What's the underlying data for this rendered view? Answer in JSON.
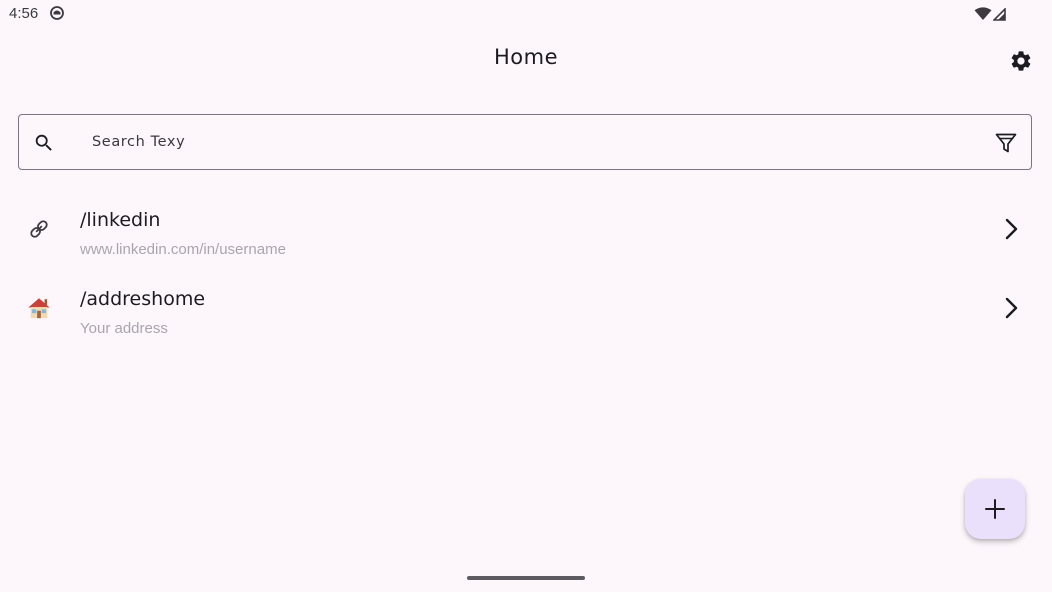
{
  "status_bar": {
    "time": "4:56",
    "app_icon": "notification-app-icon",
    "wifi_icon": "wifi-icon",
    "signal_icon": "cell-signal-icon"
  },
  "top_bar": {
    "title": "Home",
    "settings_icon": "gear-icon"
  },
  "search": {
    "placeholder": "Search Texy",
    "value": "",
    "search_icon": "search-icon",
    "filter_icon": "filter-icon"
  },
  "items": [
    {
      "title": "/linkedin",
      "subtitle": "www.linkedin.com/in/username",
      "icon": "link-icon"
    },
    {
      "title": "/addreshome",
      "subtitle": "Your address",
      "icon": "house-icon"
    }
  ],
  "fab": {
    "icon": "plus-icon"
  },
  "colors": {
    "background": "#fdf7fc",
    "fab_background": "#eae0fb",
    "subtitle_text": "#a9a5ad",
    "outline": "#7a7580"
  }
}
